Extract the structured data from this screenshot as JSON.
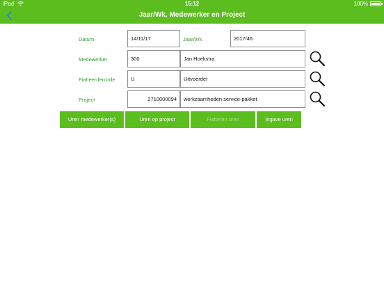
{
  "status": {
    "carrier": "iPad",
    "time": "15:12",
    "battery": "100%"
  },
  "nav": {
    "title": "Jaar/Wk, Medewerker en Project"
  },
  "form": {
    "datum_label": "Datum",
    "datum_value": "14/11/17",
    "jaarwk_label": "Jaar/Wk",
    "jaarwk_value": "2017/46",
    "medewerker_label": "Medewerker",
    "medewerker_code": "300",
    "medewerker_name": "Jan Hoekstra",
    "fiatteerder_label": "Fiatteerdercode",
    "fiatteerder_code": "U",
    "fiatteerder_name": "Uitvoerder",
    "project_label": "Project",
    "project_code": "2710000094",
    "project_name": "werkzaamheden service-pakket"
  },
  "buttons": {
    "uren_medewerkers": "Uren medewerker(s)",
    "uren_op_project": "Uren op project",
    "fiatteren_uren": "Fiatteren uren",
    "ingave_uren": "Ingave uren"
  },
  "icons": {
    "back": "chevron-left-icon",
    "search": "magnifier-icon",
    "wifi": "wifi-icon",
    "battery": "battery-icon"
  },
  "colors": {
    "brand_green": "#5cbd1f",
    "label_green": "#2e9e2e",
    "disabled_text": "#a9dd8a"
  }
}
